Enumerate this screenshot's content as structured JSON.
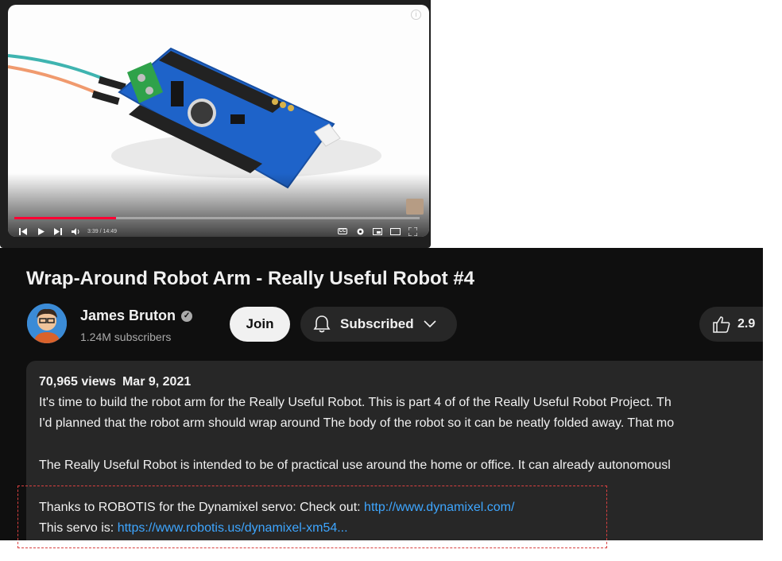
{
  "player": {
    "time_display": "3:39 / 14:49",
    "progress_fraction": 0.25,
    "info_icon": "info-icon",
    "controls_icons": [
      "skip-previous-icon",
      "play-icon",
      "skip-next-icon",
      "volume-icon",
      "captions-icon",
      "settings-icon",
      "miniplayer-icon",
      "theater-icon",
      "fullscreen-icon"
    ],
    "cc_label": "CC"
  },
  "video": {
    "title": "Wrap-Around Robot Arm - Really Useful Robot #4"
  },
  "channel": {
    "name": "James Bruton",
    "subscribers": "1.24M subscribers",
    "verified_icon": "verified-check-icon"
  },
  "actions": {
    "join_label": "Join",
    "subscribe_label": "Subscribed",
    "like_count": "2.9"
  },
  "description": {
    "views": "70,965 views",
    "date": "Mar 9, 2021",
    "lines": [
      "It's time to build the robot arm for the Really Useful Robot. This is part 4 of of the Really Useful Robot Project. Th",
      "I'd planned that the robot arm should wrap around The body of the robot so it can be neatly folded away. That mo",
      "The Really Useful Robot is intended to be of practical use around the home or office. It can already autonomousl"
    ],
    "thanks_text": "Thanks to ROBOTIS for the Dynamixel servo: Check out: ",
    "thanks_link": "http://www.dynamixel.com/",
    "servo_text": "This servo is: ",
    "servo_link": "https://www.robotis.us/dynamixel-xm54..."
  },
  "colors": {
    "accent_red": "#ff0033",
    "link_blue": "#3ea6ff",
    "page_bg": "#0f0f0f",
    "panel_bg": "#272727",
    "highlight_border": "#d94040"
  }
}
